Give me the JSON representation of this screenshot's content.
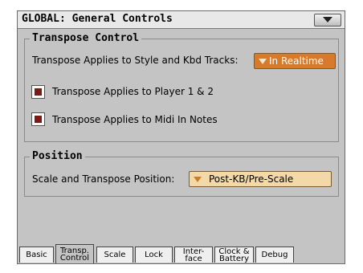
{
  "window": {
    "title": "GLOBAL: General Controls"
  },
  "transpose_group": {
    "title": "Transpose Control",
    "applies_label": "Transpose Applies to Style and Kbd Tracks:",
    "applies_value": "In Realtime",
    "player_label": "Transpose Applies to Player 1 & 2",
    "player_checked": true,
    "midi_label": "Transpose Applies to Midi In Notes",
    "midi_checked": true
  },
  "position_group": {
    "title": "Position",
    "scale_label": "Scale and Transpose Position:",
    "scale_value": "Post-KB/Pre-Scale"
  },
  "tabs": [
    {
      "line1": "Basic",
      "line2": ""
    },
    {
      "line1": "Transp.",
      "line2": "Control"
    },
    {
      "line1": "Scale",
      "line2": ""
    },
    {
      "line1": "Lock",
      "line2": ""
    },
    {
      "line1": "Inter-",
      "line2": "face"
    },
    {
      "line1": "Clock &",
      "line2": "Battery"
    },
    {
      "line1": "Debug",
      "line2": ""
    }
  ],
  "selected_tab": 1,
  "colors": {
    "popup_active": "#d87a2c",
    "popup_normal": "#f4d9a8",
    "check_mark": "#7a1a14",
    "panel": "#c4c4c4"
  },
  "icons": {
    "menu": "triangle-down-icon",
    "popup_arrow": "triangle-down-icon",
    "checkbox_mark": "filled-square-icon"
  }
}
